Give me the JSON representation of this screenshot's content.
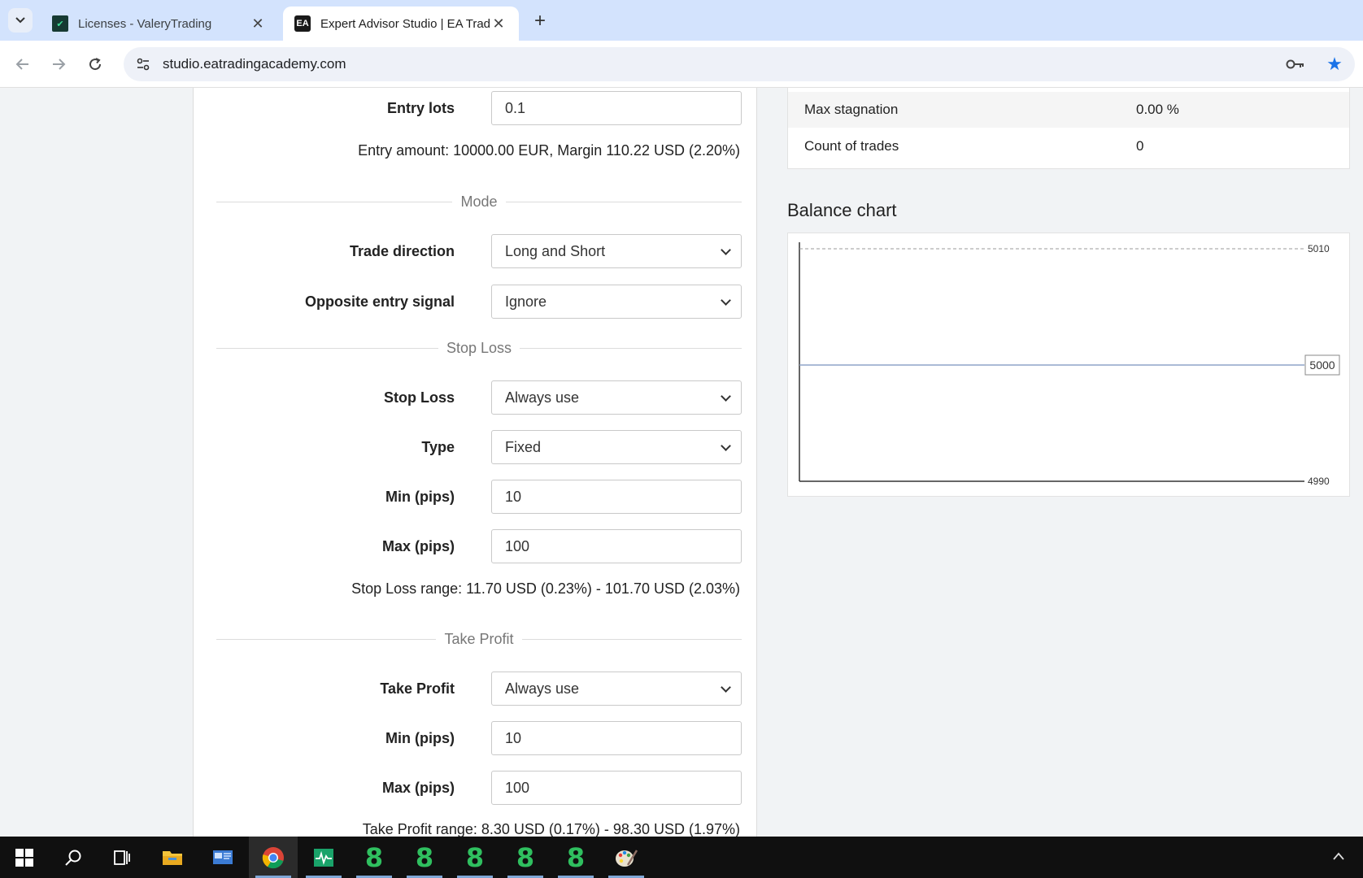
{
  "browser": {
    "tabs": [
      {
        "title": "Licenses - ValeryTrading",
        "favicon": "valerytrading-icon",
        "active": false
      },
      {
        "title": "Expert Advisor Studio | EA Tradi",
        "favicon": "ea-icon",
        "favicon_text": "EA",
        "active": true
      }
    ],
    "new_tab_label": "+",
    "url": "studio.eatradingacademy.com"
  },
  "form": {
    "entry_lots": {
      "label": "Entry lots",
      "value": "0.1"
    },
    "entry_info": "Entry amount: 10000.00 EUR, Margin 110.22 USD (2.20%)",
    "mode_section": "Mode",
    "trade_direction": {
      "label": "Trade direction",
      "value": "Long and Short"
    },
    "opposite_entry": {
      "label": "Opposite entry signal",
      "value": "Ignore"
    },
    "stop_loss_section": "Stop Loss",
    "stop_loss": {
      "label": "Stop Loss",
      "value": "Always use"
    },
    "sl_type": {
      "label": "Type",
      "value": "Fixed"
    },
    "sl_min": {
      "label": "Min (pips)",
      "value": "10"
    },
    "sl_max": {
      "label": "Max (pips)",
      "value": "100"
    },
    "sl_range": "Stop Loss range: 11.70 USD (0.23%) - 101.70 USD (2.03%)",
    "take_profit_section": "Take Profit",
    "take_profit": {
      "label": "Take Profit",
      "value": "Always use"
    },
    "tp_min": {
      "label": "Min (pips)",
      "value": "10"
    },
    "tp_max": {
      "label": "Max (pips)",
      "value": "100"
    },
    "tp_range": "Take Profit range: 8.30 USD (0.17%) - 98.30 USD (1.97%)"
  },
  "stats": [
    {
      "key": "Max stagnation",
      "value": "0.00 %"
    },
    {
      "key": "Count of trades",
      "value": "0"
    }
  ],
  "balance_chart": {
    "title": "Balance chart",
    "chart_data": {
      "type": "line",
      "title": "Balance chart",
      "xlabel": "",
      "ylabel": "",
      "ylim": [
        4990,
        5010
      ],
      "yticks": [
        "5010",
        "4990"
      ],
      "series": [
        {
          "values": [
            5000,
            5000
          ]
        }
      ],
      "current_value_label": "5000",
      "grid": false
    }
  },
  "taskbar": {
    "items": [
      "start-icon",
      "search-icon",
      "task-view-icon",
      "file-explorer-icon",
      "control-panel-icon",
      "chrome-icon",
      "activity-monitor-icon",
      "app-8-icon",
      "app-8-icon",
      "app-8-icon",
      "app-8-icon",
      "app-8-icon",
      "paint-icon"
    ],
    "eight_glyph": "8"
  },
  "colors": {
    "accent": "#1a73e8",
    "tabbar": "#d3e3fd",
    "taskbar": "#101010",
    "app8": "#2fbf5f"
  }
}
